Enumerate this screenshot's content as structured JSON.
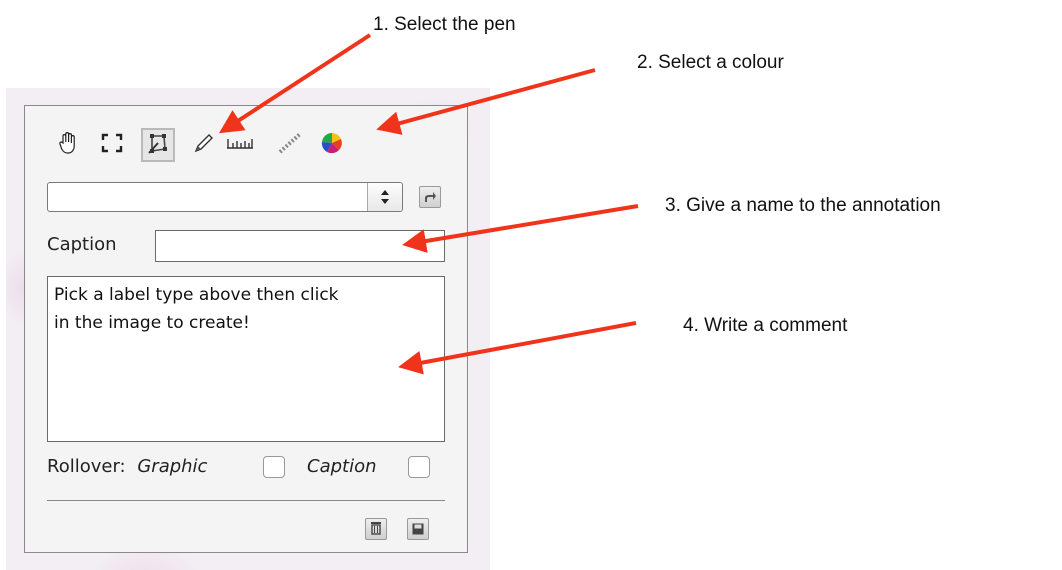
{
  "toolbar": {
    "tools": [
      {
        "icon": "hand-icon"
      },
      {
        "icon": "selection-rect-icon"
      },
      {
        "icon": "polygon-icon",
        "selected": true
      },
      {
        "icon": "pen-icon"
      },
      {
        "icon": "ruler-icon"
      },
      {
        "icon": "dashed-line-icon"
      },
      {
        "icon": "colour-wheel-icon"
      }
    ]
  },
  "label_select": {
    "value": ""
  },
  "caption": {
    "label": "Caption",
    "value": ""
  },
  "comment": {
    "text": "Pick a label type above then click\nin the image to create!"
  },
  "rollover": {
    "label": "Rollover:",
    "graphic_label": "Graphic",
    "caption_label": "Caption",
    "graphic_checked": false,
    "caption_checked": false
  },
  "annotations": {
    "step1": "1. Select the pen",
    "step2": "2. Select a colour",
    "step3": "3. Give a name to the annotation",
    "step4": "4. Write a comment"
  },
  "colors": {
    "arrow": "#f0341c",
    "panel_border": "#8a8a8a"
  }
}
